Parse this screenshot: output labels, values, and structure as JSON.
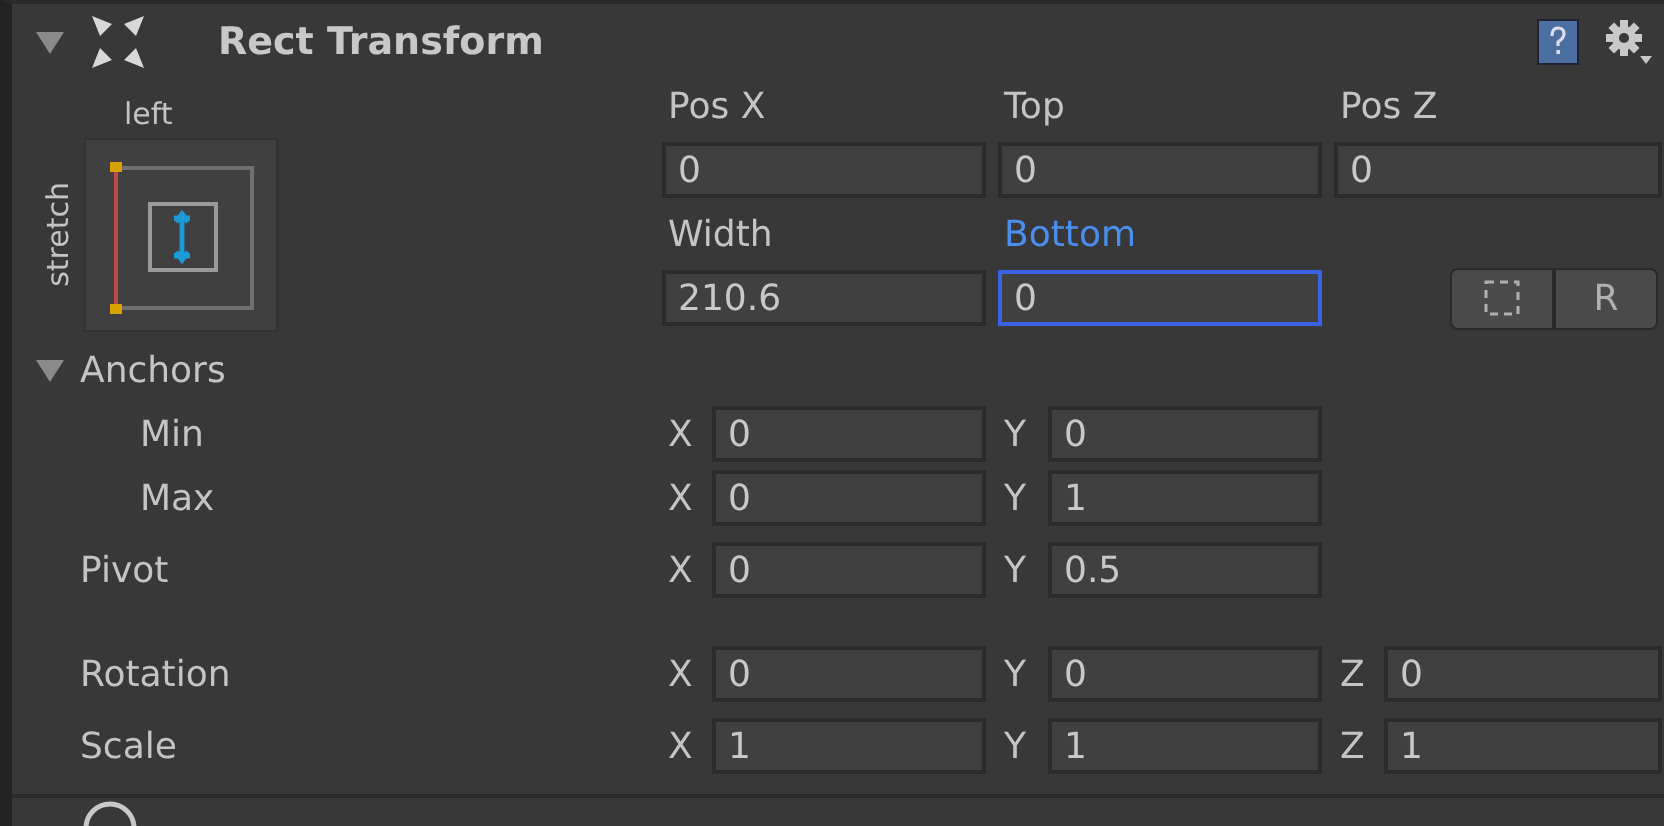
{
  "component": {
    "title": "Rect Transform",
    "expanded": true
  },
  "anchor_preset": {
    "horizontal": "left",
    "vertical": "stretch"
  },
  "offset_rows": [
    {
      "fields": [
        {
          "label": "Pos X",
          "value": "0",
          "focused": false
        },
        {
          "label": "Top",
          "value": "0",
          "focused": false
        },
        {
          "label": "Pos Z",
          "value": "0",
          "focused": false
        }
      ]
    },
    {
      "fields": [
        {
          "label": "Width",
          "value": "210.6",
          "focused": false
        },
        {
          "label": "Bottom",
          "value": "0",
          "focused": true
        }
      ]
    }
  ],
  "mode_buttons": [
    {
      "kind": "blueprint"
    },
    {
      "kind": "raw",
      "label": "R"
    }
  ],
  "anchors": {
    "label": "Anchors",
    "expanded": true,
    "rows": [
      {
        "label": "Min",
        "fields": [
          {
            "axis": "X",
            "value": "0"
          },
          {
            "axis": "Y",
            "value": "0"
          }
        ]
      },
      {
        "label": "Max",
        "fields": [
          {
            "axis": "X",
            "value": "0"
          },
          {
            "axis": "Y",
            "value": "1"
          }
        ]
      }
    ]
  },
  "vectors": [
    {
      "label": "Pivot",
      "fields": [
        {
          "axis": "X",
          "value": "0"
        },
        {
          "axis": "Y",
          "value": "0.5"
        }
      ]
    },
    {
      "label": "Rotation",
      "fields": [
        {
          "axis": "X",
          "value": "0"
        },
        {
          "axis": "Y",
          "value": "0"
        },
        {
          "axis": "Z",
          "value": "0"
        }
      ]
    },
    {
      "label": "Scale",
      "fields": [
        {
          "axis": "X",
          "value": "1"
        },
        {
          "axis": "Y",
          "value": "1"
        },
        {
          "axis": "Z",
          "value": "1"
        }
      ]
    }
  ]
}
